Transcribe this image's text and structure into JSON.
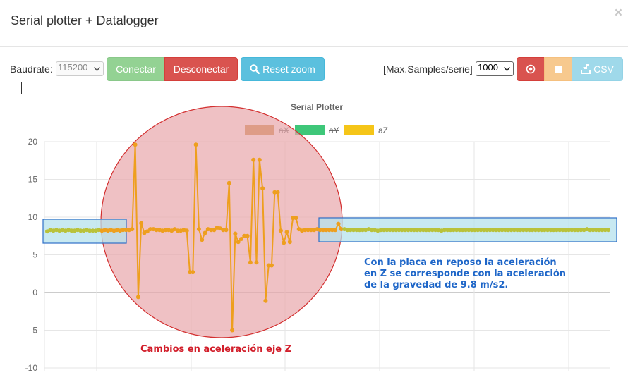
{
  "header": {
    "title": "Serial plotter + Datalogger",
    "close_label": "×"
  },
  "toolbar": {
    "baud_label": "Baudrate:",
    "baud_value": "115200",
    "connect_label": "Conectar",
    "disconnect_label": "Desconectar",
    "reset_zoom_label": "Reset zoom",
    "max_samples_label": "[Max.Samples/serie]",
    "max_samples_value": "1000",
    "csv_label": "CSV"
  },
  "colors": {
    "connect": "#93d293",
    "disconnect": "#d9534f",
    "reset": "#5bc0de",
    "record": "#d9534f",
    "stop": "#f7c98e",
    "csv": "#9fd9ea",
    "aX": "#c78433",
    "aY": "#3ec779",
    "aZ": "#f5c518",
    "circle_fill": "#e8a6ab",
    "circle_stroke": "#d32f2f",
    "box_fill": "#b6e1ec",
    "box_stroke": "#2e6fc7",
    "annotation_red": "#d21f2b",
    "annotation_blue": "#1e66c8"
  },
  "chart_data": {
    "type": "line",
    "title": "Serial Plotter",
    "legend": [
      {
        "name": "aX",
        "hidden": true
      },
      {
        "name": "aY",
        "hidden": true
      },
      {
        "name": "aZ",
        "hidden": false
      }
    ],
    "ylim": [
      -10,
      20
    ],
    "yticks": [
      "20",
      "15",
      "10",
      "5",
      "0",
      "-5",
      "-10"
    ],
    "grid": true,
    "series": [
      {
        "name": "aZ",
        "values": [
          8.1,
          8.3,
          8.2,
          8.3,
          8.2,
          8.3,
          8.2,
          8.3,
          8.2,
          8.2,
          8.3,
          8.2,
          8.2,
          8.3,
          8.2,
          8.2,
          8.2,
          8.3,
          8.2,
          8.3,
          8.2,
          8.3,
          8.2,
          8.3,
          8.2,
          8.3,
          8.3,
          8.3,
          8.4,
          19.6,
          -0.6,
          9.2,
          7.9,
          8.1,
          8.4,
          8.4,
          8.3,
          8.3,
          8.2,
          8.3,
          8.3,
          8.2,
          8.4,
          8.2,
          8.2,
          8.3,
          8.2,
          2.7,
          2.7,
          19.6,
          8.4,
          7.0,
          7.9,
          8.4,
          8.3,
          8.3,
          8.6,
          8.5,
          8.3,
          8.3,
          14.5,
          -5.0,
          7.8,
          6.7,
          7.1,
          7.5,
          7.5,
          4.0,
          17.6,
          4.0,
          17.6,
          13.8,
          -1.1,
          3.6,
          3.6,
          13.3,
          13.3,
          8.2,
          6.6,
          8.0,
          6.7,
          9.9,
          9.9,
          8.4,
          8.2,
          8.3,
          8.3,
          8.3,
          8.3,
          8.4,
          8.3,
          8.3,
          8.3,
          8.3,
          8.3,
          8.3,
          9.1,
          8.4,
          8.4,
          8.3,
          8.3,
          8.3,
          8.3,
          8.3,
          8.3,
          8.3,
          8.4,
          8.3,
          8.3,
          8.2,
          8.3,
          8.3,
          8.3,
          8.3,
          8.3,
          8.3,
          8.3,
          8.3,
          8.3,
          8.3,
          8.3,
          8.3,
          8.3,
          8.3,
          8.3,
          8.3,
          8.3,
          8.3,
          8.3,
          8.3,
          8.2,
          8.3,
          8.3,
          8.3,
          8.3,
          8.3,
          8.3,
          8.3,
          8.3,
          8.3,
          8.3,
          8.3,
          8.3,
          8.3,
          8.3,
          8.3,
          8.3,
          8.3,
          8.3,
          8.3,
          8.3,
          8.3,
          8.3,
          8.3,
          8.3,
          8.3,
          8.3,
          8.3,
          8.3,
          8.3,
          8.3,
          8.3,
          8.3,
          8.3,
          8.3,
          8.3,
          8.3,
          8.3,
          8.3,
          8.3,
          8.3,
          8.3,
          8.3,
          8.3,
          8.3,
          8.3,
          8.3,
          8.3,
          8.4,
          8.3,
          8.3,
          8.3,
          8.3,
          8.3,
          8.3,
          8.3
        ]
      }
    ],
    "annotations": [
      "Cambios en aceleración eje Z",
      "Con la placa en reposo la aceleración",
      "en Z se corresponde con la aceleración",
      "de la gravedad de 9.8 m/s2."
    ]
  }
}
